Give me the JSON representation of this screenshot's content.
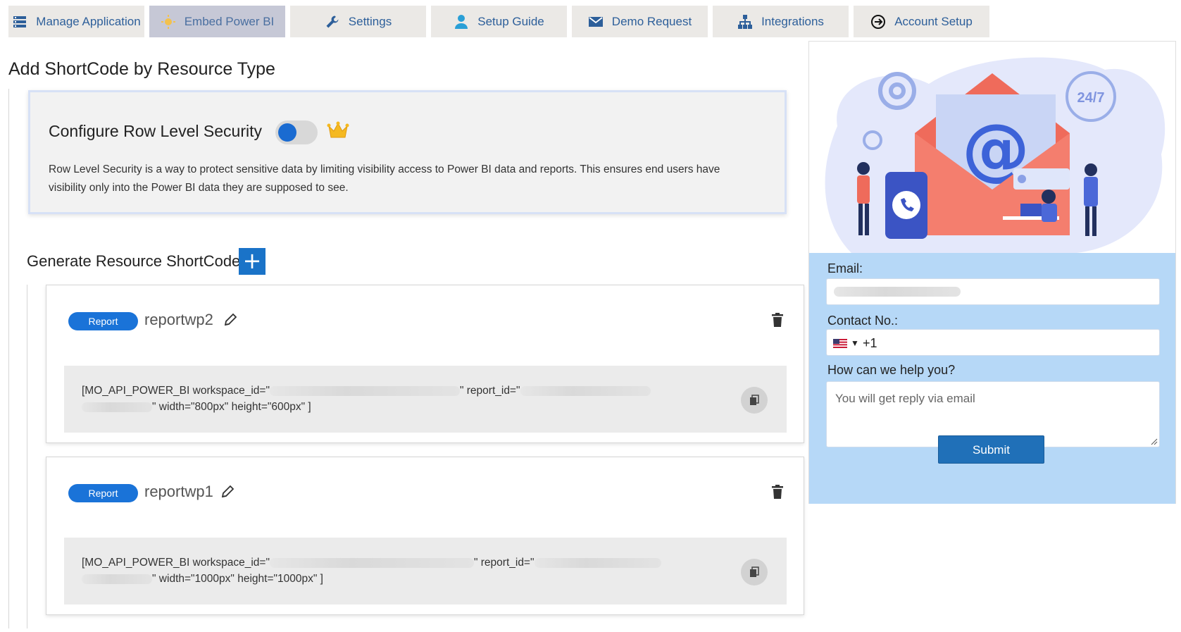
{
  "tabs": [
    {
      "label": "Manage Application",
      "icon": "list-icon",
      "active": false
    },
    {
      "label": "Embed Power BI",
      "icon": "sun-icon",
      "active": true
    },
    {
      "label": "Settings",
      "icon": "wrench-icon",
      "active": false
    },
    {
      "label": "Setup Guide",
      "icon": "user-icon",
      "active": false
    },
    {
      "label": "Demo Request",
      "icon": "envelope-icon",
      "active": false
    },
    {
      "label": "Integrations",
      "icon": "sitemap-icon",
      "active": false
    },
    {
      "label": "Account Setup",
      "icon": "sign-in-icon",
      "active": false
    }
  ],
  "main": {
    "title": "Add ShortCode by Resource Type",
    "rls": {
      "title": "Configure Row Level Security",
      "toggle_on": false,
      "description": "Row Level Security is a way to protect sensitive data by limiting visibility access to Power BI data and reports. This ensures end users have visibility only into the Power BI data they are supposed to see."
    },
    "generate": {
      "title": "Generate Resource ShortCode",
      "add_label": "+"
    },
    "shortcodes": [
      {
        "badge": "Report",
        "name": "reportwp2",
        "code_line1_a": "[MO_API_POWER_BI workspace_id=\"",
        "code_line1_b": "\" report_id=\"",
        "code_line2_b": "\" width=\"800px\" height=\"600px\" ]"
      },
      {
        "badge": "Report",
        "name": "reportwp1",
        "code_line1_a": "[MO_API_POWER_BI workspace_id=\"",
        "code_line1_b": "\" report_id=\"",
        "code_line2_b": "\" width=\"1000px\" height=\"1000px\" ]"
      }
    ]
  },
  "contact": {
    "illustration_badge": "24/7",
    "email_label": "Email:",
    "email_value": "",
    "contact_label": "Contact No.:",
    "dial_code": "+1",
    "help_label": "How can we help you?",
    "help_placeholder": "You will get reply via email",
    "submit_label": "Submit"
  },
  "colors": {
    "accent": "#1a73c8",
    "tab_bg": "#ebe9e6",
    "tab_active_bg": "#c6c8d6",
    "form_bg": "#b6d8f7",
    "submit_bg": "#2070b8"
  }
}
